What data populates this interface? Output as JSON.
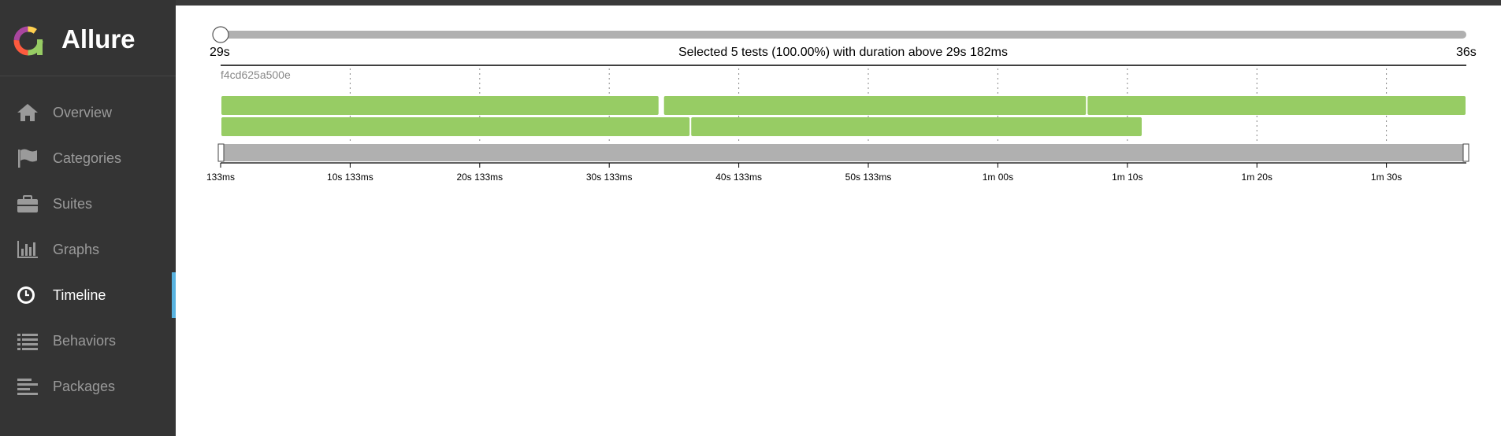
{
  "app": {
    "name": "Allure"
  },
  "sidebar": {
    "items": [
      {
        "label": "Overview",
        "icon": "home-icon"
      },
      {
        "label": "Categories",
        "icon": "flag-icon"
      },
      {
        "label": "Suites",
        "icon": "briefcase-icon"
      },
      {
        "label": "Graphs",
        "icon": "bar-chart-icon"
      },
      {
        "label": "Timeline",
        "icon": "clock-icon",
        "active": true
      },
      {
        "label": "Behaviors",
        "icon": "list-icon"
      },
      {
        "label": "Packages",
        "icon": "align-left-icon"
      }
    ]
  },
  "colors": {
    "passed": "#97cc64",
    "sidebar": "#343434",
    "active_marker": "#59b3e0",
    "slider": "#b0b0b0"
  },
  "timeline": {
    "slider_min_label": "29s",
    "slider_max_label": "36s",
    "selection_text": "Selected 5 tests (100.00%) with duration above 29s 182ms",
    "host_label": "f4cd625a500e",
    "tick_labels": [
      "133ms",
      "10s 133ms",
      "20s 133ms",
      "30s 133ms",
      "40s 133ms",
      "50s 133ms",
      "1m 00s",
      "1m 10s",
      "1m 20s",
      "1m 30s"
    ]
  },
  "chart_data": {
    "type": "timeline",
    "x_unit": "seconds",
    "x_range": [
      0.133,
      96.3
    ],
    "tick_values": [
      0.133,
      10.133,
      20.133,
      30.133,
      40.133,
      50.133,
      60.133,
      70.133,
      80.133,
      90.133
    ],
    "tests": [
      {
        "row": 0,
        "start": 0.133,
        "end": 34.0,
        "status": "passed"
      },
      {
        "row": 0,
        "start": 34.3,
        "end": 67.0,
        "status": "passed"
      },
      {
        "row": 0,
        "start": 67.0,
        "end": 96.3,
        "status": "passed"
      },
      {
        "row": 1,
        "start": 0.133,
        "end": 36.4,
        "status": "passed"
      },
      {
        "row": 1,
        "start": 36.4,
        "end": 71.3,
        "status": "passed"
      }
    ]
  }
}
